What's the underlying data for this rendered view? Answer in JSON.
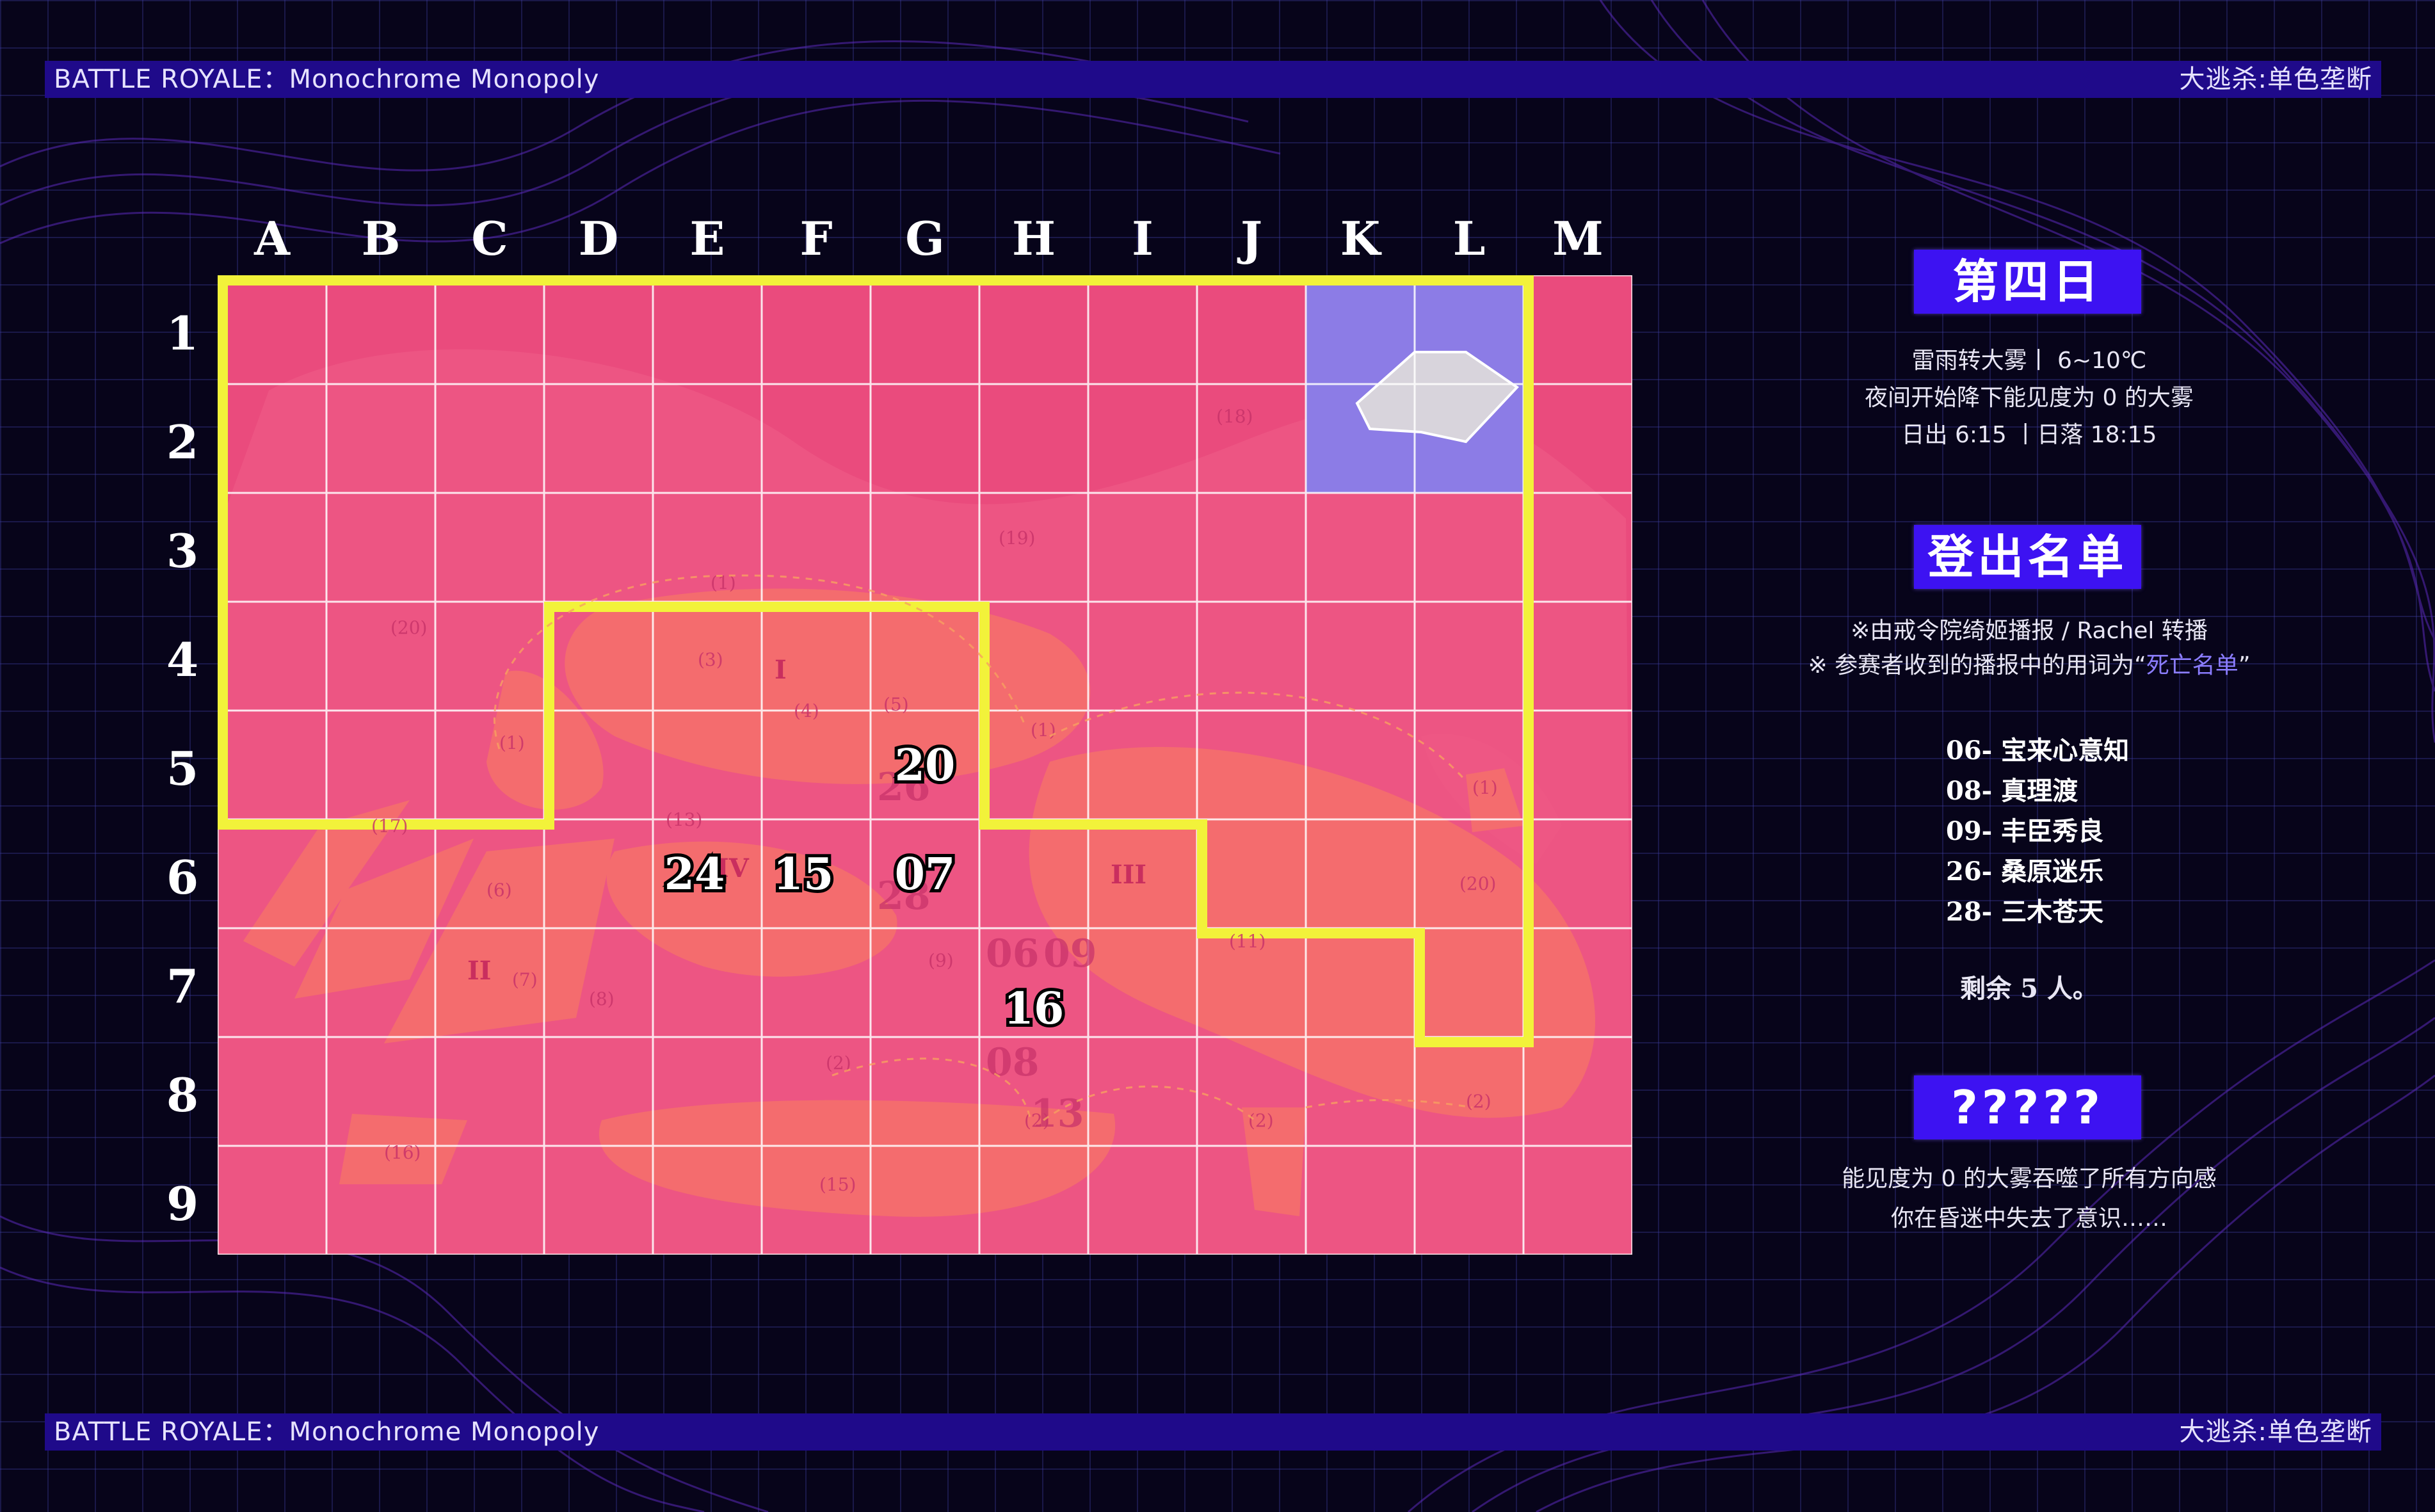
{
  "header": {
    "title_left": "BATTLE ROYALE：Monochrome Monopoly",
    "title_right": "大逃杀:单色垄断"
  },
  "footer": {
    "title_left": "BATTLE ROYALE：Monochrome Monopoly",
    "title_right": "大逃杀:单色垄断"
  },
  "map": {
    "columns": [
      "A",
      "B",
      "C",
      "D",
      "E",
      "F",
      "G",
      "H",
      "I",
      "J",
      "K",
      "L",
      "M"
    ],
    "rows": [
      "1",
      "2",
      "3",
      "4",
      "5",
      "6",
      "7",
      "8",
      "9"
    ],
    "colors": {
      "base": "#ea4b7d",
      "land": "#f46c6e",
      "highlight_zone": "#8c7ce6",
      "boundary": "#f2f23a",
      "grid": "#ffffff",
      "marker_text": "#ffffff"
    },
    "players": [
      {
        "label": "20",
        "col": "G",
        "row": "5"
      },
      {
        "label": "07",
        "col": "G",
        "row": "6"
      },
      {
        "label": "24",
        "col": "E",
        "row": "6"
      },
      {
        "label": "15",
        "col": "F",
        "row": "6"
      },
      {
        "label": "16",
        "col": "H",
        "row": "7"
      }
    ],
    "ghost_labels": [
      "26",
      "28",
      "06",
      "09",
      "08",
      "13"
    ],
    "zone_numerals": [
      "I",
      "II",
      "III",
      "IV"
    ],
    "small_numbers": [
      "(18)",
      "(19)",
      "(20)",
      "(3)",
      "(4)",
      "(5)",
      "(1)",
      "(1)",
      "(1)",
      "(1)",
      "(6)",
      "(7)",
      "(8)",
      "(9)",
      "(11)",
      "(20)",
      "(2)",
      "(2)",
      "(2)",
      "(2)",
      "(16)",
      "(15)",
      "(13)",
      "(17)"
    ]
  },
  "sidebar": {
    "day_label": "第四日",
    "weather_lines": [
      "雷雨转大雾丨 6~10℃",
      "夜间开始降下能见度为 0 的大雾",
      "日出 6:15 丨日落 18:15"
    ],
    "roster_label": "登出名单",
    "roster_note_1": "※由戒令院绮姬播报 / Rachel 转播",
    "roster_note_2_prefix": "※ 参赛者收到的播报中的用词为“",
    "roster_note_2_em": "死亡名单",
    "roster_note_2_suffix": "”",
    "roster": [
      "06- 宝来心意知",
      "08- 真理渡",
      "09- 丰臣秀良",
      "26- 桑原迷乐",
      "28- 三木苍天"
    ],
    "remaining": "剩余 5 人。",
    "mystery_label": "?????",
    "mystery_lines": [
      "能见度为 0 的大雾吞噬了所有方向感",
      "你在昏迷中失去了意识……"
    ]
  }
}
